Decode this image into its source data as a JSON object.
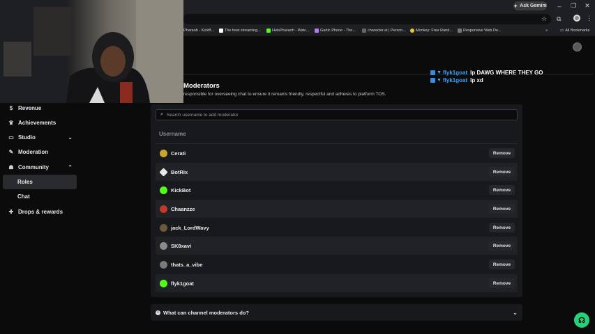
{
  "browser": {
    "ask_gemini": "Ask Gemini",
    "bookmarks": [
      {
        "label": "dPharaoh - KickB...",
        "color": "#53fc18"
      },
      {
        "label": "The best streaming...",
        "color": "#ffffff"
      },
      {
        "label": "HelsPharaoh - Watc...",
        "color": "#53fc18"
      },
      {
        "label": "Gartic Phone - The...",
        "color": "#b57bff"
      },
      {
        "label": "character.ai | Person...",
        "color": "#cccccc"
      },
      {
        "label": "Monkey: Free Rand...",
        "color": "#f0c040"
      },
      {
        "label": "Responsive Web De...",
        "color": "#999999"
      }
    ],
    "all_bookmarks": "All Bookmarks"
  },
  "sidebar": {
    "items": [
      {
        "label": "Revenue",
        "icon": "dollar-icon",
        "glyph": "$"
      },
      {
        "label": "Achievements",
        "icon": "trophy-icon",
        "glyph": "🏆"
      },
      {
        "label": "Studio",
        "icon": "studio-icon",
        "glyph": "▭",
        "chevron": "down"
      },
      {
        "label": "Moderation",
        "icon": "wrench-icon",
        "glyph": "🔧"
      },
      {
        "label": "Community",
        "icon": "people-icon",
        "glyph": "👥",
        "chevron": "up"
      },
      {
        "label": "Roles",
        "sub": true,
        "active": true
      },
      {
        "label": "Chat",
        "sub": true
      },
      {
        "label": "Drops & rewards",
        "icon": "gift-icon",
        "glyph": "🎁"
      }
    ]
  },
  "main": {
    "title": "Moderators",
    "description": "responsible for overseeing chat to ensure it remains friendly, respectful and adheres to platform TOS.",
    "search_placeholder": "Search username to add moderator",
    "column_header": "Username",
    "remove_label": "Remove",
    "moderators": [
      {
        "name": "Cerati",
        "avatar_color": "#c9a531"
      },
      {
        "name": "BotRix",
        "avatar_color": "#e8e8e8"
      },
      {
        "name": "KickBot",
        "avatar_color": "#53fc18"
      },
      {
        "name": "Chaanzze",
        "avatar_color": "#c0392b"
      },
      {
        "name": "jack_LordWavy",
        "avatar_color": "#6b5a3a"
      },
      {
        "name": "SK8xavi",
        "avatar_color": "#8a8a8a"
      },
      {
        "name": "thats_a_vibe",
        "avatar_color": "#7a7a7a"
      },
      {
        "name": "flyk1goat",
        "avatar_color": "#53fc18"
      }
    ],
    "faq": "What can channel moderators do?"
  },
  "chat_overlay": [
    {
      "user": "flyk1goat",
      "message": "lp DAWG WHERE THEY GO"
    },
    {
      "user": "flyk1goat",
      "message": "lp xd"
    }
  ],
  "colors": {
    "accent": "#53fc18",
    "help": "#27d17a",
    "chat_user": "#3ea6ff"
  }
}
